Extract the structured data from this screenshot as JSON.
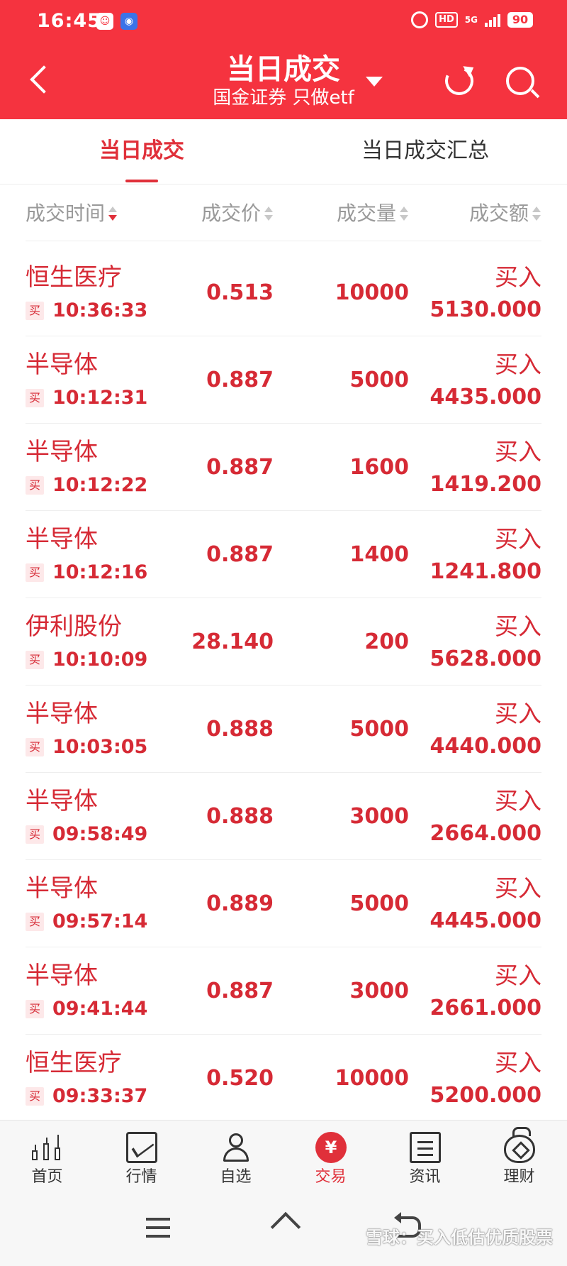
{
  "status_bar": {
    "time": "16:45",
    "left_icons": [
      "notification-icon",
      "app-badge-icon"
    ],
    "hd": "HD",
    "network": "5G",
    "battery": "90"
  },
  "header": {
    "title": "当日成交",
    "subtitle": "国金证券 只做etf"
  },
  "tabs": [
    {
      "label": "当日成交",
      "active": true
    },
    {
      "label": "当日成交汇总",
      "active": false
    }
  ],
  "columns": [
    "成交时间",
    "成交价",
    "成交量",
    "成交额"
  ],
  "rows": [
    {
      "name": "恒生医疗",
      "side": "买",
      "time": "10:36:33",
      "price": "0.513",
      "qty": "10000",
      "action": "买入",
      "amount": "5130.000"
    },
    {
      "name": "半导体",
      "side": "买",
      "time": "10:12:31",
      "price": "0.887",
      "qty": "5000",
      "action": "买入",
      "amount": "4435.000"
    },
    {
      "name": "半导体",
      "side": "买",
      "time": "10:12:22",
      "price": "0.887",
      "qty": "1600",
      "action": "买入",
      "amount": "1419.200"
    },
    {
      "name": "半导体",
      "side": "买",
      "time": "10:12:16",
      "price": "0.887",
      "qty": "1400",
      "action": "买入",
      "amount": "1241.800"
    },
    {
      "name": "伊利股份",
      "side": "买",
      "time": "10:10:09",
      "price": "28.140",
      "qty": "200",
      "action": "买入",
      "amount": "5628.000"
    },
    {
      "name": "半导体",
      "side": "买",
      "time": "10:03:05",
      "price": "0.888",
      "qty": "5000",
      "action": "买入",
      "amount": "4440.000"
    },
    {
      "name": "半导体",
      "side": "买",
      "time": "09:58:49",
      "price": "0.888",
      "qty": "3000",
      "action": "买入",
      "amount": "2664.000"
    },
    {
      "name": "半导体",
      "side": "买",
      "time": "09:57:14",
      "price": "0.889",
      "qty": "5000",
      "action": "买入",
      "amount": "4445.000"
    },
    {
      "name": "半导体",
      "side": "买",
      "time": "09:41:44",
      "price": "0.887",
      "qty": "3000",
      "action": "买入",
      "amount": "2661.000"
    },
    {
      "name": "恒生医疗",
      "side": "买",
      "time": "09:33:37",
      "price": "0.520",
      "qty": "10000",
      "action": "买入",
      "amount": "5200.000"
    }
  ],
  "bottom_nav": [
    {
      "label": "首页",
      "icon": "candlestick-icon"
    },
    {
      "label": "行情",
      "icon": "chart-icon"
    },
    {
      "label": "自选",
      "icon": "user-check-icon"
    },
    {
      "label": "交易",
      "icon": "yuan-icon",
      "active": true
    },
    {
      "label": "资讯",
      "icon": "document-icon"
    },
    {
      "label": "理财",
      "icon": "money-bag-icon"
    }
  ],
  "trade_icon_glyph": "¥",
  "watermark": "雪球：买入低估优质股票",
  "colors": {
    "brand": "#f5333f",
    "price_red": "#d62a35"
  }
}
